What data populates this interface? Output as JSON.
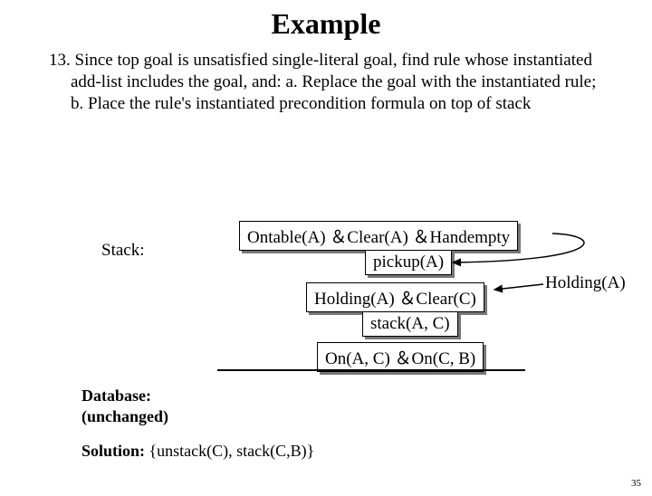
{
  "title": "Example",
  "paragraph": "13. Since top goal is unsatisfied single-literal goal, find rule whose instantiated add-list includes the goal, and:  a. Replace the goal with the instantiated rule; b. Place the rule's instantiated precondition formula on top of stack",
  "stack_label": "Stack:",
  "boxes": {
    "precond": "Ontable(A) ＆Clear(A) ＆Handempty",
    "pickup": "pickup(A)",
    "hold_clear": "Holding(A) ＆Clear(C)",
    "stack_ac": "stack(A, C)",
    "on_goal": "On(A, C) ＆On(C, B)",
    "holding_a": "Holding(A)"
  },
  "database_label": "Database:\n(unchanged)",
  "solution_label": "Solution:",
  "solution_value": "{unstack(C), stack(C,B)}",
  "page_number": "35"
}
